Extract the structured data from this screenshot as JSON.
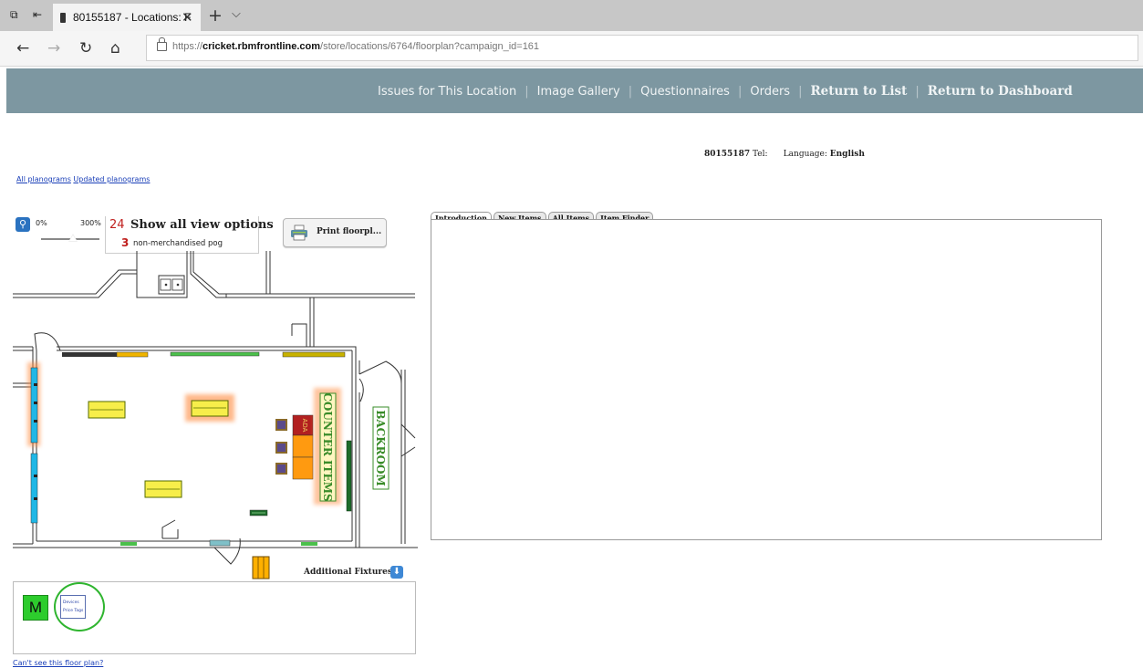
{
  "browser": {
    "tab_title": "80155187 - Locations: F",
    "url_prefix": "https://",
    "url_host": "cricket.rbmfrontline.com",
    "url_path": "/store/locations/6764/floorplan?campaign_id=161"
  },
  "nav": {
    "issues": "Issues for This Location",
    "gallery": "Image Gallery",
    "questionnaires": "Questionnaires",
    "orders": "Orders",
    "return_list": "Return to List",
    "return_dashboard": "Return to Dashboard"
  },
  "store": {
    "number": "80155187",
    "tel_label": "Tel:",
    "language_label": "Language:",
    "language": "English"
  },
  "links": {
    "all_planograms": "All planograms",
    "updated_planograms": "Updated planograms",
    "cant_see": "Can't see this floor plan?"
  },
  "floorplan": {
    "zoom_min": "0%",
    "zoom_max": "300%",
    "zoom_level": 0.55,
    "view_count": "24",
    "show_all": "Show all view options",
    "non_merch_count": "3",
    "non_merch_label": "non-merchandised pog",
    "print_label": "Print floorpl...",
    "counter_label": "COUNTER ITEMS",
    "backroom_label": "BACKROOM",
    "ada_label": "ADA",
    "additional_fixtures": "Additional Fixtures",
    "fixture_m": "M",
    "fixture_devices": "Devices",
    "fixture_price_tags": "Price Tags"
  },
  "tabs": [
    "Introduction",
    "New Items",
    "All Items",
    "Item Finder"
  ],
  "icons": {
    "tab_actions": "tab-actions-icon",
    "zoom": "magnifier-icon",
    "print": "printer-icon",
    "expand": "arrow-down-icon"
  }
}
